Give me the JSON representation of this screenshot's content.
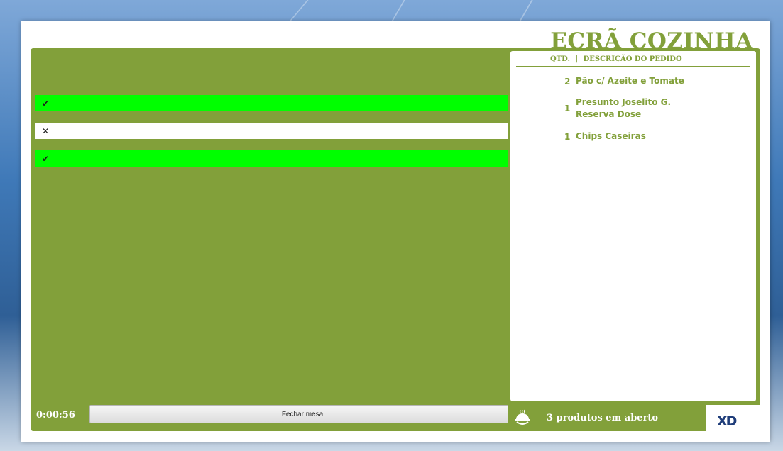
{
  "app": {
    "title": "ECRÃ COZINHA"
  },
  "left": {
    "rows": [
      {
        "status": "done",
        "icon": "check-icon",
        "glyph": "✔"
      },
      {
        "status": "cancelled",
        "icon": "x-icon",
        "glyph": "✕"
      },
      {
        "status": "done",
        "icon": "check-icon",
        "glyph": "✔"
      }
    ],
    "timer": "0:00:56",
    "close_button": "Fechar mesa"
  },
  "order": {
    "header_qty": "QTD.",
    "header_sep": "|",
    "header_desc": "DESCRIÇÃO DO PEDIDO",
    "items": [
      {
        "qty": "2",
        "desc": "Pão c/ Azeite e Tomate"
      },
      {
        "qty": "1",
        "desc": "Presunto Joselito G. Reserva Dose"
      },
      {
        "qty": "1",
        "desc": "Chips Caseiras"
      }
    ]
  },
  "status": {
    "text": "3 produtos em aberto",
    "icon": "cloche-icon"
  },
  "logo": {
    "text": "XD"
  },
  "colors": {
    "accent": "#82a03a",
    "done": "#00ff00",
    "cancelled": "#ffffff",
    "logo": "#1f3d7a"
  }
}
